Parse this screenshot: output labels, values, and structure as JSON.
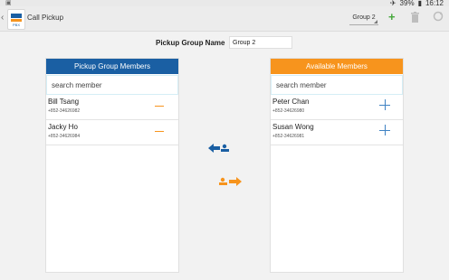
{
  "statusbar": {
    "left": "▣",
    "time": "16:12",
    "battery": "39%"
  },
  "actionbar": {
    "title": "Call Pickup",
    "app_logo_text": "PBX",
    "group_spinner": "Group 2",
    "actions": [
      "add",
      "delete",
      "sync"
    ]
  },
  "form": {
    "group_name_label": "Pickup Group Name",
    "group_name_value": "Group 2"
  },
  "members_panel": {
    "header": "Pickup Group Members",
    "search_placeholder": "search member",
    "items": [
      {
        "name": "Bill Tsang",
        "phone": "+852-34626982"
      },
      {
        "name": "Jacky Ho",
        "phone": "+852-34626984"
      }
    ]
  },
  "available_panel": {
    "header": "Available Members",
    "search_placeholder": "search member",
    "items": [
      {
        "name": "Peter Chan",
        "phone": "+852-34626980"
      },
      {
        "name": "Susan Wong",
        "phone": "+852-34626981"
      }
    ]
  },
  "colors": {
    "blue": "#1a5fa3",
    "orange": "#f7941d",
    "green": "#46a83c"
  }
}
